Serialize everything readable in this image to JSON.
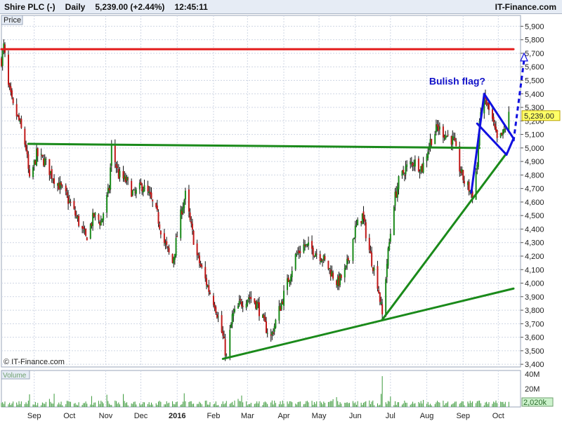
{
  "header": {
    "instrument": "Shire PLC (-)",
    "period": "Daily",
    "quote": "5,239.00 (+2.44%)",
    "time": "12:45:11",
    "site": "IT-Finance.com"
  },
  "chart_data": {
    "type": "candlestick",
    "price_label": "Price",
    "volume_label": "Volume",
    "watermark": "© IT-Finance.com",
    "annotation": "Bulish flag?",
    "last_price_label": "5,239.00",
    "ylim": [
      3380,
      5980
    ],
    "y_ticks": [
      3400,
      3500,
      3600,
      3700,
      3800,
      3900,
      4000,
      4100,
      4200,
      4300,
      4400,
      4500,
      4600,
      4700,
      4800,
      4900,
      5000,
      5100,
      5200,
      5300,
      5400,
      5500,
      5600,
      5700,
      5800,
      5900
    ],
    "y_tick_labels": [
      "3,400",
      "3,500",
      "3,600",
      "3,700",
      "3,800",
      "3,900",
      "4,000",
      "4,100",
      "4,200",
      "4,300",
      "4,400",
      "4,500",
      "4,600",
      "4,700",
      "4,800",
      "4,900",
      "5,000",
      "5,100",
      "5,200",
      "5,300",
      "5,400",
      "5,500",
      "5,600",
      "5,700",
      "5,800",
      "5,900"
    ],
    "x_labels": [
      {
        "label": "Sep",
        "x": "2015-09-01"
      },
      {
        "label": "Oct",
        "x": "2015-10-01"
      },
      {
        "label": "Nov",
        "x": "2015-11-01"
      },
      {
        "label": "Dec",
        "x": "2015-12-01"
      },
      {
        "label": "2016",
        "x": "2016-01-01",
        "bold": true
      },
      {
        "label": "Feb",
        "x": "2016-02-01"
      },
      {
        "label": "Mar",
        "x": "2016-03-01"
      },
      {
        "label": "Apr",
        "x": "2016-04-01"
      },
      {
        "label": "May",
        "x": "2016-05-01"
      },
      {
        "label": "Jun",
        "x": "2016-06-01"
      },
      {
        "label": "Jul",
        "x": "2016-07-01"
      },
      {
        "label": "Aug",
        "x": "2016-08-01"
      },
      {
        "label": "Sep",
        "x": "2016-09-01"
      },
      {
        "label": "Oct",
        "x": "2016-10-01"
      }
    ],
    "xlim": [
      "2015-08-04",
      "2016-10-20"
    ],
    "price_path": [
      [
        "2015-08-04",
        5650
      ],
      [
        "2015-08-06",
        5750
      ],
      [
        "2015-08-10",
        5450
      ],
      [
        "2015-08-14",
        5300
      ],
      [
        "2015-08-19",
        5200
      ],
      [
        "2015-08-25",
        5000
      ],
      [
        "2015-08-28",
        4750
      ],
      [
        "2015-09-03",
        4950
      ],
      [
        "2015-09-10",
        4900
      ],
      [
        "2015-09-16",
        4800
      ],
      [
        "2015-09-24",
        4700
      ],
      [
        "2015-10-01",
        4600
      ],
      [
        "2015-10-09",
        4450
      ],
      [
        "2015-10-15",
        4330
      ],
      [
        "2015-10-22",
        4500
      ],
      [
        "2015-10-28",
        4450
      ],
      [
        "2015-11-04",
        4700
      ],
      [
        "2015-11-06",
        5000
      ],
      [
        "2015-11-12",
        4800
      ],
      [
        "2015-11-19",
        4750
      ],
      [
        "2015-11-25",
        4650
      ],
      [
        "2015-12-02",
        4720
      ],
      [
        "2015-12-08",
        4650
      ],
      [
        "2015-12-15",
        4500
      ],
      [
        "2015-12-21",
        4300
      ],
      [
        "2015-12-28",
        4150
      ],
      [
        "2016-01-05",
        4550
      ],
      [
        "2016-01-08",
        4650
      ],
      [
        "2016-01-12",
        4450
      ],
      [
        "2016-01-18",
        4200
      ],
      [
        "2016-01-22",
        4100
      ],
      [
        "2016-01-28",
        3950
      ],
      [
        "2016-02-02",
        3850
      ],
      [
        "2016-02-09",
        3600
      ],
      [
        "2016-02-12",
        3450
      ],
      [
        "2016-02-17",
        3750
      ],
      [
        "2016-02-24",
        3850
      ],
      [
        "2016-03-02",
        3900
      ],
      [
        "2016-03-09",
        3850
      ],
      [
        "2016-03-15",
        3700
      ],
      [
        "2016-03-21",
        3600
      ],
      [
        "2016-03-28",
        3800
      ],
      [
        "2016-04-04",
        4000
      ],
      [
        "2016-04-11",
        4200
      ],
      [
        "2016-04-18",
        4280
      ],
      [
        "2016-04-25",
        4250
      ],
      [
        "2016-05-03",
        4200
      ],
      [
        "2016-05-10",
        4100
      ],
      [
        "2016-05-17",
        4000
      ],
      [
        "2016-05-24",
        4100
      ],
      [
        "2016-06-01",
        4400
      ],
      [
        "2016-06-07",
        4500
      ],
      [
        "2016-06-14",
        4200
      ],
      [
        "2016-06-20",
        4000
      ],
      [
        "2016-06-24",
        3760
      ],
      [
        "2016-06-28",
        4150
      ],
      [
        "2016-07-04",
        4600
      ],
      [
        "2016-07-08",
        4750
      ],
      [
        "2016-07-14",
        4850
      ],
      [
        "2016-07-21",
        4900
      ],
      [
        "2016-07-28",
        4850
      ],
      [
        "2016-08-04",
        5050
      ],
      [
        "2016-08-10",
        5150
      ],
      [
        "2016-08-17",
        5100
      ],
      [
        "2016-08-24",
        5050
      ],
      [
        "2016-08-29",
        4850
      ],
      [
        "2016-09-02",
        4750
      ],
      [
        "2016-09-06",
        4700
      ],
      [
        "2016-09-09",
        4650
      ],
      [
        "2016-09-13",
        4880
      ],
      [
        "2016-09-16",
        5300
      ],
      [
        "2016-09-20",
        5350
      ],
      [
        "2016-09-26",
        5200
      ],
      [
        "2016-09-30",
        5050
      ],
      [
        "2016-10-05",
        5100
      ],
      [
        "2016-10-10",
        5239
      ]
    ],
    "spike_low": {
      "x": "2016-06-24",
      "low": 3720
    },
    "volume_axis_labels": [
      "40M",
      "20M"
    ],
    "volume_last_label": "2,020k",
    "volume_spike": {
      "x": "2016-06-24",
      "value": 38
    },
    "trendlines": [
      {
        "name": "resistance",
        "color": "#e31a1a",
        "from": [
          "2015-08-04",
          5730
        ],
        "to": [
          "2016-10-14",
          5730
        ]
      },
      {
        "name": "neckline",
        "color": "#1a8a1a",
        "from": [
          "2015-08-27",
          5030
        ],
        "to": [
          "2016-09-15",
          5000
        ]
      },
      {
        "name": "support-low",
        "color": "#1a8a1a",
        "from": [
          "2016-02-09",
          3440
        ],
        "to": [
          "2016-10-14",
          3960
        ]
      },
      {
        "name": "support-high",
        "color": "#1a8a1a",
        "from": [
          "2016-06-24",
          3730
        ],
        "to": [
          "2016-10-08",
          4960
        ]
      }
    ],
    "flag_lines": [
      {
        "from": [
          "2016-09-08",
          4670
        ],
        "to": [
          "2016-09-19",
          5400
        ]
      },
      {
        "from": [
          "2016-09-19",
          5400
        ],
        "to": [
          "2016-10-14",
          5070
        ]
      },
      {
        "from": [
          "2016-09-13",
          5180
        ],
        "to": [
          "2016-10-08",
          4950
        ]
      },
      {
        "from": [
          "2016-10-08",
          4950
        ],
        "to": [
          "2016-10-14",
          5070
        ]
      }
    ],
    "projection": {
      "from": [
        "2016-10-14",
        5050
      ],
      "to": [
        "2016-10-23",
        5650
      ],
      "tip": [
        "2016-10-23",
        5690
      ]
    },
    "colors": {
      "up": "#1a8a1a",
      "down": "#c01818",
      "wick": "#111111",
      "grid": "#cfd6e4",
      "flag": "#1010e0",
      "annotation": "#1010c8",
      "last_price_bg": "#ffff66",
      "volume_bar": "#3c9a3c"
    }
  }
}
